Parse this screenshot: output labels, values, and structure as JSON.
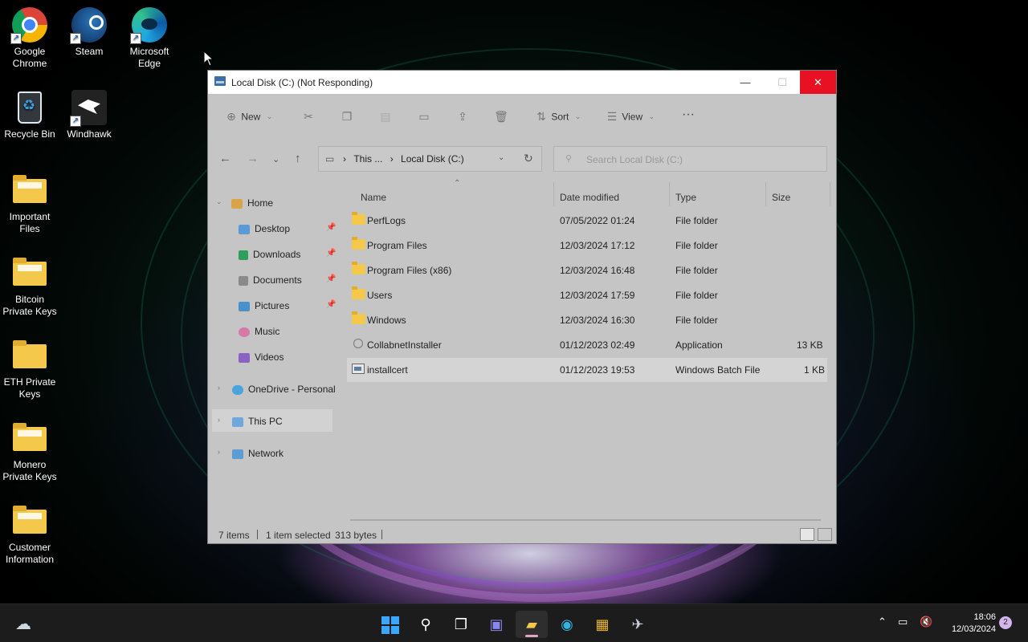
{
  "desktop": {
    "icons": [
      {
        "label": "Google Chrome",
        "icon": "chrome-icon"
      },
      {
        "label": "Steam",
        "icon": "steam-icon"
      },
      {
        "label": "Microsoft Edge",
        "icon": "edge-icon"
      },
      {
        "label": "Recycle Bin",
        "icon": "recycle-bin-icon"
      },
      {
        "label": "Windhawk",
        "icon": "windhawk-icon"
      },
      {
        "label": "Important Files",
        "icon": "folder-icon"
      },
      {
        "label": "Bitcoin Private Keys",
        "icon": "folder-icon"
      },
      {
        "label": "ETH Private Keys",
        "icon": "folder-icon"
      },
      {
        "label": "Monero Private Keys",
        "icon": "folder-icon"
      },
      {
        "label": "Customer Information",
        "icon": "folder-icon"
      }
    ]
  },
  "window": {
    "title": "Local Disk (C:) (Not Responding)",
    "controls": {
      "minimize": "—",
      "maximize": "☐",
      "close": "✕"
    }
  },
  "ribbon": {
    "new_label": "New",
    "sort_label": "Sort",
    "view_label": "View",
    "more_label": "···"
  },
  "address": {
    "crumb_this": "This ...",
    "crumb_sep": "›",
    "crumb_current": "Local Disk (C:)",
    "search_placeholder": "Search Local Disk (C:)"
  },
  "navpane": {
    "home": "Home",
    "quick": [
      {
        "label": "Desktop",
        "pinned": true
      },
      {
        "label": "Downloads",
        "pinned": true
      },
      {
        "label": "Documents",
        "pinned": true
      },
      {
        "label": "Pictures",
        "pinned": true
      },
      {
        "label": "Music",
        "pinned": false
      },
      {
        "label": "Videos",
        "pinned": false
      }
    ],
    "onedrive": "OneDrive - Personal",
    "thispc": "This PC",
    "network": "Network"
  },
  "columns": {
    "name": "Name",
    "date": "Date modified",
    "type": "Type",
    "size": "Size"
  },
  "files": [
    {
      "name": "PerfLogs",
      "date": "07/05/2022 01:24",
      "type": "File folder",
      "size": "",
      "kind": "folder"
    },
    {
      "name": "Program Files",
      "date": "12/03/2024 17:12",
      "type": "File folder",
      "size": "",
      "kind": "folder"
    },
    {
      "name": "Program Files (x86)",
      "date": "12/03/2024 16:48",
      "type": "File folder",
      "size": "",
      "kind": "folder"
    },
    {
      "name": "Users",
      "date": "12/03/2024 17:59",
      "type": "File folder",
      "size": "",
      "kind": "folder"
    },
    {
      "name": "Windows",
      "date": "12/03/2024 16:30",
      "type": "File folder",
      "size": "",
      "kind": "folder"
    },
    {
      "name": "CollabnetInstaller",
      "date": "01/12/2023 02:49",
      "type": "Application",
      "size": "13 KB",
      "kind": "app"
    },
    {
      "name": "installcert",
      "date": "01/12/2023 19:53",
      "type": "Windows Batch File",
      "size": "1 KB",
      "kind": "batch",
      "selected": true
    }
  ],
  "status": {
    "items": "7 items",
    "selected": "1 item selected",
    "bytes": "313 bytes"
  },
  "taskbar": {
    "time": "18:06",
    "date": "12/03/2024",
    "notifications": "2"
  }
}
